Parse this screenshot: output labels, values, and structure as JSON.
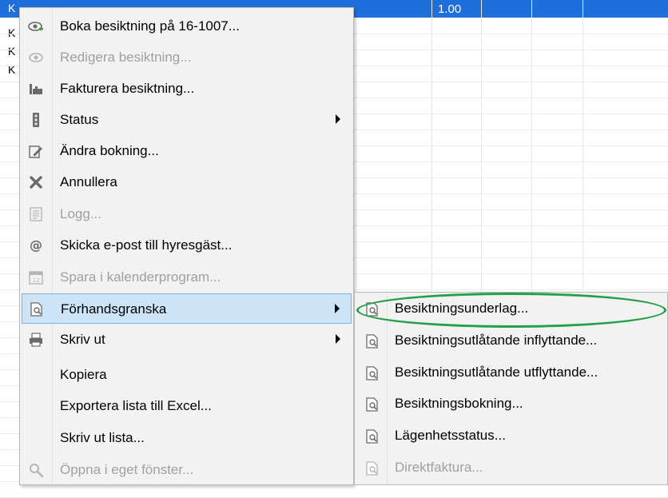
{
  "grid": {
    "selected_value": "1.00",
    "row_prefix": "K"
  },
  "menu": {
    "items": [
      {
        "label": "Boka besiktning på 16-1007...",
        "icon": "eye-plus-icon",
        "disabled": false,
        "submenu": false
      },
      {
        "label": "Redigera besiktning...",
        "icon": "eye-icon",
        "disabled": true,
        "submenu": false
      },
      {
        "label": "Fakturera besiktning...",
        "icon": "invoice-icon",
        "disabled": false,
        "submenu": false
      },
      {
        "label": "Status",
        "icon": "traffic-light-icon",
        "disabled": false,
        "submenu": true
      },
      {
        "label": "Ändra bokning...",
        "icon": "edit-icon",
        "disabled": false,
        "submenu": false
      },
      {
        "label": "Annullera",
        "icon": "cross-icon",
        "disabled": false,
        "submenu": false
      },
      {
        "label": "Logg...",
        "icon": "log-icon",
        "disabled": true,
        "submenu": false
      },
      {
        "label": "Skicka e-post till hyresgäst...",
        "icon": "at-icon",
        "disabled": false,
        "submenu": false
      },
      {
        "label": "Spara i kalenderprogram...",
        "icon": "calendar-icon",
        "disabled": true,
        "submenu": false
      },
      {
        "label": "Förhandsgranska",
        "icon": "preview-icon",
        "disabled": false,
        "submenu": true,
        "highlighted": true
      },
      {
        "label": "Skriv ut",
        "icon": "printer-icon",
        "disabled": false,
        "submenu": true
      },
      {
        "label": "Kopiera",
        "icon": "",
        "disabled": false,
        "submenu": false
      },
      {
        "label": "Exportera lista till Excel...",
        "icon": "",
        "disabled": false,
        "submenu": false
      },
      {
        "label": "Skriv ut lista...",
        "icon": "",
        "disabled": false,
        "submenu": false
      },
      {
        "label": "Öppna i eget fönster...",
        "icon": "magnifier-icon",
        "disabled": true,
        "submenu": false
      }
    ]
  },
  "submenu": {
    "items": [
      {
        "label": "Besiktningsunderlag...",
        "icon": "preview-icon",
        "disabled": false
      },
      {
        "label": "Besiktningsutlåtande inflyttande...",
        "icon": "preview-icon",
        "disabled": false
      },
      {
        "label": "Besiktningsutlåtande utflyttande...",
        "icon": "preview-icon",
        "disabled": false
      },
      {
        "label": "Besiktningsbokning...",
        "icon": "preview-icon",
        "disabled": false
      },
      {
        "label": "Lägenhetsstatus...",
        "icon": "preview-icon",
        "disabled": false
      },
      {
        "label": "Direktfaktura...",
        "icon": "preview-icon",
        "disabled": true
      }
    ]
  },
  "colors": {
    "selection_blue": "#1e6fd9",
    "highlight_bg": "#cce4f7",
    "highlight_border": "#7ab4e6",
    "annotation_green": "#22a14a"
  }
}
